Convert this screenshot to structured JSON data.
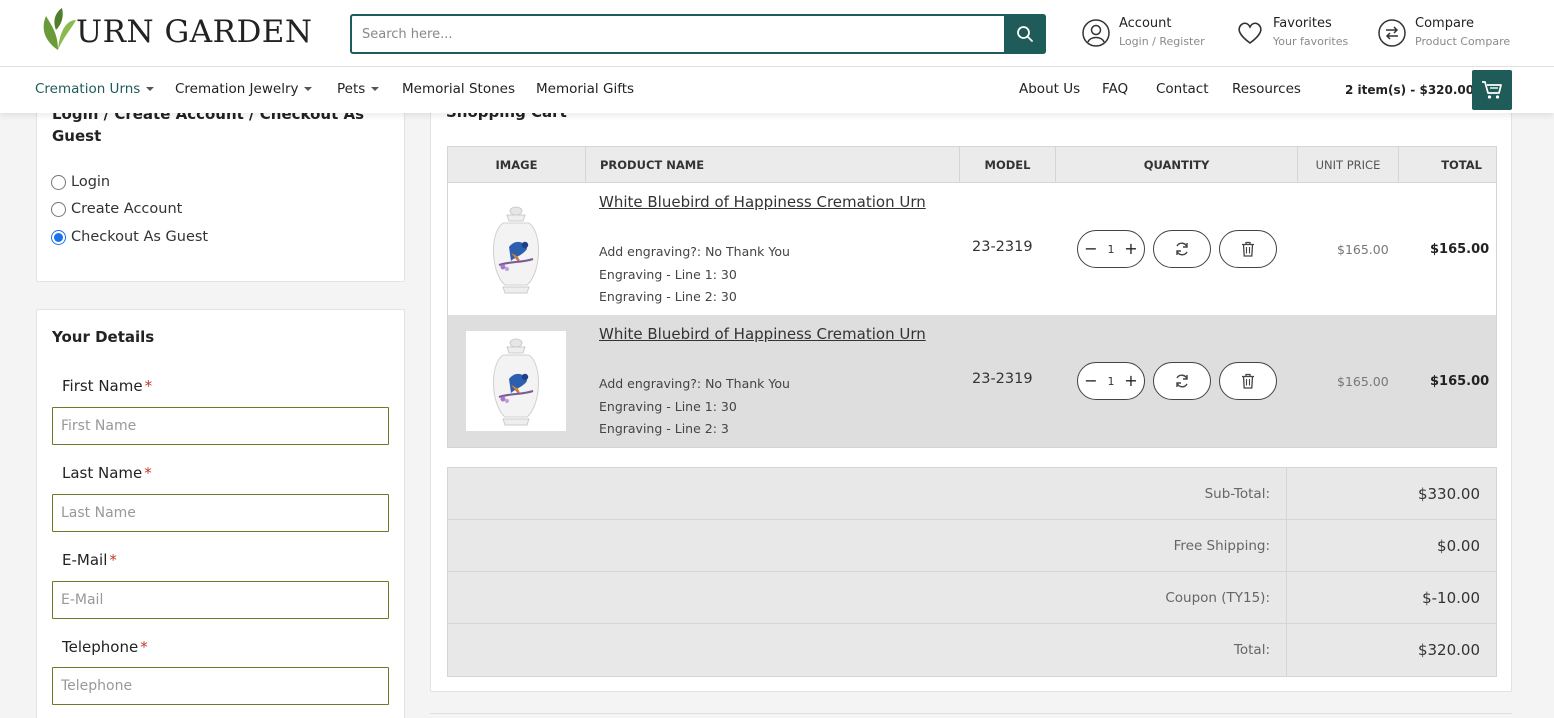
{
  "brand": {
    "name": "URN GARDEN"
  },
  "search": {
    "placeholder": "Search here..."
  },
  "header": {
    "account": {
      "title": "Account",
      "sub": "Login / Register"
    },
    "favorites": {
      "title": "Favorites",
      "sub": "Your favorites"
    },
    "compare": {
      "title": "Compare",
      "sub": "Product Compare"
    }
  },
  "nav": {
    "left": [
      "Cremation Urns",
      "Cremation Jewelry",
      "Pets",
      "Memorial Stones",
      "Memorial Gifts"
    ],
    "right": [
      "About Us",
      "FAQ",
      "Contact",
      "Resources"
    ],
    "cart_summary": "2 item(s) - $320.00"
  },
  "checkout": {
    "heading": "Login / Create Account / Checkout As Guest",
    "options": [
      "Login",
      "Create Account",
      "Checkout As Guest"
    ],
    "selected": "Checkout As Guest"
  },
  "details": {
    "heading": "Your Details",
    "fields": [
      {
        "label": "First Name",
        "placeholder": "First Name"
      },
      {
        "label": "Last Name",
        "placeholder": "Last Name"
      },
      {
        "label": "E-Mail",
        "placeholder": "E-Mail"
      },
      {
        "label": "Telephone",
        "placeholder": "Telephone"
      }
    ]
  },
  "cart": {
    "heading": "Shopping Cart",
    "columns": [
      "IMAGE",
      "PRODUCT NAME",
      "MODEL",
      "QUANTITY",
      "UNIT PRICE",
      "TOTAL"
    ],
    "items": [
      {
        "name": "White Bluebird of Happiness Cremation Urn",
        "options": [
          "Add engraving?: No Thank You",
          "Engraving - Line 1: 30",
          "Engraving - Line 2: 30"
        ],
        "model": "23-2319",
        "quantity": "1",
        "unit_price": "$165.00",
        "total": "$165.00"
      },
      {
        "name": "White Bluebird of Happiness Cremation Urn",
        "options": [
          "Add engraving?: No Thank You",
          "Engraving - Line 1: 30",
          "Engraving - Line 2: 3"
        ],
        "model": "23-2319",
        "quantity": "1",
        "unit_price": "$165.00",
        "total": "$165.00"
      }
    ],
    "totals": [
      {
        "label": "Sub-Total:",
        "value": "$330.00"
      },
      {
        "label": "Free Shipping:",
        "value": "$0.00"
      },
      {
        "label": "Coupon (TY15):",
        "value": "$-10.00"
      },
      {
        "label": "Total:",
        "value": "$320.00"
      }
    ]
  },
  "colors": {
    "brand": "#1f5b59",
    "leaf": "#6a9a3a",
    "input_border": "#6d7a28",
    "required": "#c0392b"
  }
}
